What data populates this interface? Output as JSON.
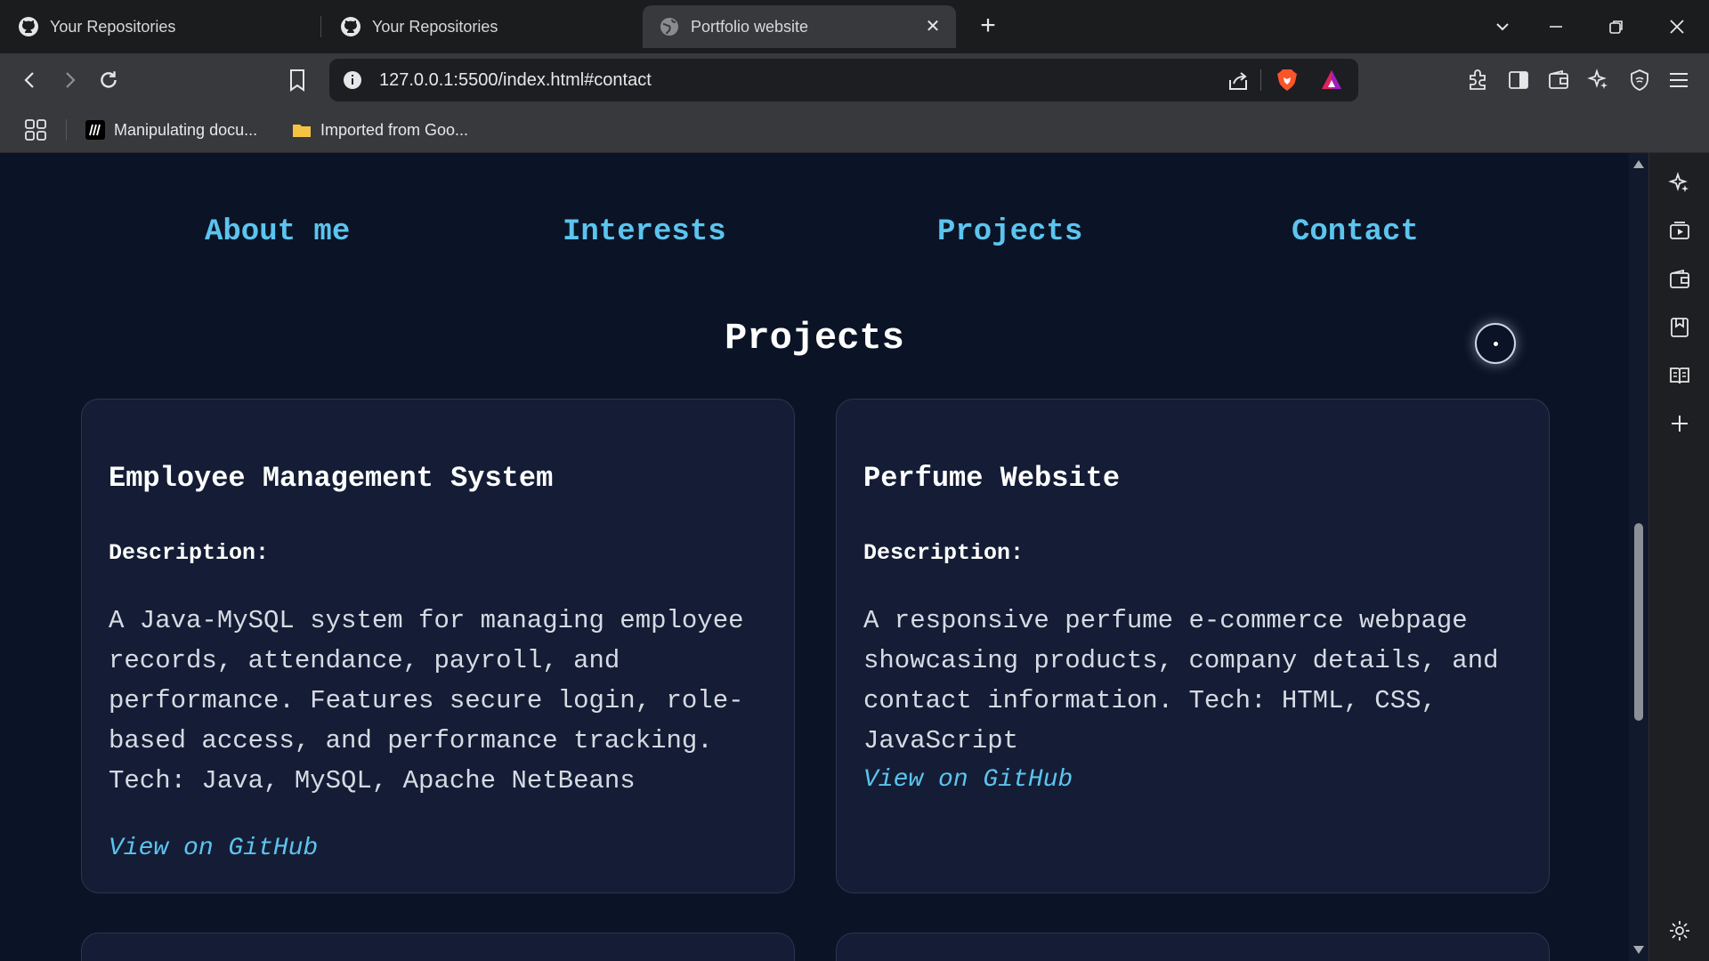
{
  "browser": {
    "tabs": [
      {
        "title": "Your Repositories"
      },
      {
        "title": "Your Repositories"
      },
      {
        "title": "Portfolio website"
      }
    ],
    "url": "127.0.0.1:5500/index.html#contact",
    "bookmarks": [
      {
        "label": "Manipulating docu..."
      },
      {
        "label": "Imported from Goo..."
      }
    ]
  },
  "nav": {
    "items": [
      "About me",
      "Interests",
      "Projects",
      "Contact"
    ]
  },
  "section": {
    "title": "Projects"
  },
  "projects": [
    {
      "title": "Employee Management System",
      "desc_heading": "Description:",
      "lines": [
        "A Java-MySQL system for managing employee",
        "records, attendance, payroll, and",
        "performance. Features secure login, role-",
        "based access, and performance tracking.",
        "Tech: Java, MySQL, Apache NetBeans"
      ],
      "link": "View on GitHub"
    },
    {
      "title": "Perfume Website",
      "desc_heading": "Description:",
      "lines": [
        "A responsive perfume e-commerce webpage",
        "showcasing products, company details, and",
        "contact information. Tech: HTML, CSS,",
        "JavaScript"
      ],
      "link": "View on GitHub"
    }
  ],
  "colors": {
    "page_background": "#0b1426",
    "card_background": "#141d35",
    "accent": "#5cc4ee",
    "heading": "#ffffff",
    "body_text": "#d6dae3"
  }
}
